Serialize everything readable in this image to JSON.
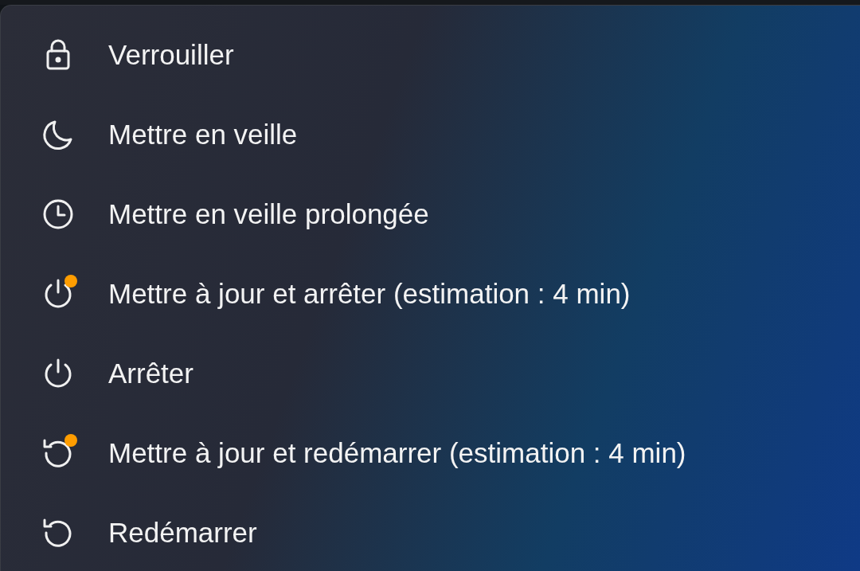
{
  "menu": {
    "items": [
      {
        "kind": "lock",
        "label": "Verrouiller",
        "update_pending": false
      },
      {
        "kind": "moon",
        "label": "Mettre en veille",
        "update_pending": false
      },
      {
        "kind": "clock",
        "label": "Mettre en veille prolongée",
        "update_pending": false
      },
      {
        "kind": "power",
        "label": "Mettre à jour et arrêter (estimation : 4 min)",
        "update_pending": true
      },
      {
        "kind": "power",
        "label": "Arrêter",
        "update_pending": false
      },
      {
        "kind": "restart",
        "label": "Mettre à jour et redémarrer (estimation : 4 min)",
        "update_pending": true
      },
      {
        "kind": "restart",
        "label": "Redémarrer",
        "update_pending": false
      }
    ]
  }
}
